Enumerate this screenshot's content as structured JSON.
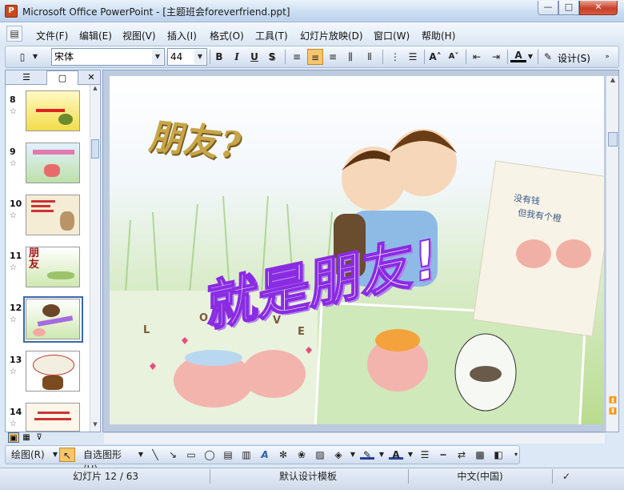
{
  "window": {
    "title": "Microsoft Office PowerPoint - [主题班会foreverfriend.ppt]"
  },
  "menu": [
    "文件(F)",
    "编辑(E)",
    "视图(V)",
    "插入(I)",
    "格式(O)",
    "工具(T)",
    "幻灯片放映(D)",
    "窗口(W)",
    "帮助(H)"
  ],
  "toolbar": {
    "font_name": "宋体",
    "font_size": "44",
    "bold": "B",
    "italic": "I",
    "underline": "U",
    "shadow": "S",
    "font_color_label": "A",
    "design_label": "设计(S)"
  },
  "thumbnails": [
    {
      "num": "8"
    },
    {
      "num": "9"
    },
    {
      "num": "10"
    },
    {
      "num": "11",
      "caption": "朋友"
    },
    {
      "num": "12"
    },
    {
      "num": "13"
    },
    {
      "num": "14"
    }
  ],
  "slide": {
    "title_art": "朋友?",
    "main_text": "就是朋友!",
    "note_line1": "没有钱",
    "note_line2": "但我有个橙",
    "letters": [
      "L",
      "O",
      "V",
      "E"
    ]
  },
  "drawbar": {
    "draw_label": "绘图(R)",
    "autoshape_label": "自选图形(U)"
  },
  "status": {
    "slide_info": "幻灯片 12 / 63",
    "template": "默认设计模板",
    "language": "中文(中国)"
  },
  "colors": {
    "accent": "#c9491d",
    "purple_text": "#8a2be2"
  }
}
